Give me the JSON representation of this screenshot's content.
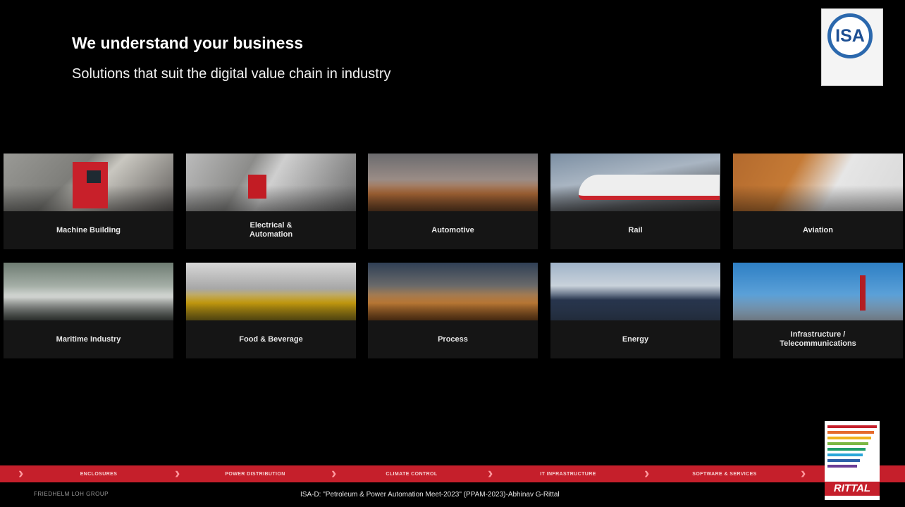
{
  "slide": {
    "title": "We understand your business",
    "subtitle": "Solutions that suit the digital value chain in industry"
  },
  "logos": {
    "isa_text": "ISA",
    "rittal_text": "RITTAL"
  },
  "industries": [
    {
      "label": "Machine Building",
      "icon": "machine-photo"
    },
    {
      "label": "Electrical &\nAutomation",
      "icon": "electrical-photo"
    },
    {
      "label": "Automotive",
      "icon": "automotive-photo"
    },
    {
      "label": "Rail",
      "icon": "rail-photo"
    },
    {
      "label": "Aviation",
      "icon": "aviation-photo"
    },
    {
      "label": "Maritime Industry",
      "icon": "maritime-photo"
    },
    {
      "label": "Food & Beverage",
      "icon": "food-photo"
    },
    {
      "label": "Process",
      "icon": "process-photo"
    },
    {
      "label": "Energy",
      "icon": "energy-photo"
    },
    {
      "label": "Infrastructure /\nTelecommunications",
      "icon": "infrastructure-photo"
    }
  ],
  "nav_bar": {
    "items": [
      "ENCLOSURES",
      "POWER DISTRIBUTION",
      "CLIMATE CONTROL",
      "IT INFRASTRUCTURE",
      "SOFTWARE & SERVICES"
    ]
  },
  "footer": {
    "group": "FRIEDHELM LOH GROUP",
    "caption": "ISA-D: \"Petroleum & Power Automation Meet-2023\" (PPAM-2023)-Abhinav G-Rittal"
  },
  "colors": {
    "background": "#000000",
    "rittal_red": "#c51f2b",
    "isa_blue": "#2b68ad"
  }
}
